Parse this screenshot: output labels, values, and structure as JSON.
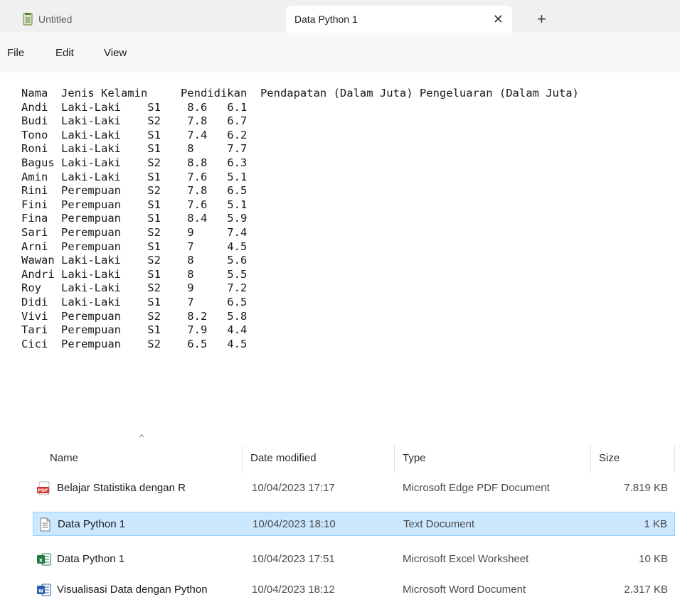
{
  "notepad": {
    "tabs": [
      {
        "title": "Untitled"
      },
      {
        "title": "Data Python 1"
      }
    ],
    "menu": [
      "File",
      "Edit",
      "View"
    ],
    "content": "Nama  Jenis Kelamin     Pendidikan  Pendapatan (Dalam Juta) Pengeluaran (Dalam Juta)\nAndi  Laki-Laki    S1    8.6   6.1\nBudi  Laki-Laki    S2    7.8   6.7\nTono  Laki-Laki    S1    7.4   6.2\nRoni  Laki-Laki    S1    8     7.7\nBagus Laki-Laki    S2    8.8   6.3\nAmin  Laki-Laki    S1    7.6   5.1\nRini  Perempuan    S2    7.8   6.5\nFini  Perempuan    S1    7.6   5.1\nFina  Perempuan    S1    8.4   5.9\nSari  Perempuan    S2    9     7.4\nArni  Perempuan    S1    7     4.5\nWawan Laki-Laki    S2    8     5.6\nAndri Laki-Laki    S1    8     5.5\nRoy   Laki-Laki    S2    9     7.2\nDidi  Laki-Laki    S1    7     6.5\nVivi  Perempuan    S2    8.2   5.8\nTari  Perempuan    S1    7.9   4.4\nCici  Perempuan    S2    6.5   4.5"
  },
  "explorer": {
    "columns": {
      "name": "Name",
      "date": "Date modified",
      "type": "Type",
      "size": "Size"
    },
    "files": [
      {
        "name": "Belajar Statistika dengan R",
        "date": "10/04/2023 17:17",
        "type": "Microsoft Edge PDF Document",
        "size": "7.819 KB",
        "icon": "pdf-file-icon",
        "selected": false
      },
      {
        "name": "Data Python 1",
        "date": "10/04/2023 18:10",
        "type": "Text Document",
        "size": "1 KB",
        "icon": "text-file-icon",
        "selected": true
      },
      {
        "name": "Data Python 1",
        "date": "10/04/2023 17:51",
        "type": "Microsoft Excel Worksheet",
        "size": "10 KB",
        "icon": "excel-file-icon",
        "selected": false
      },
      {
        "name": "Visualisasi Data dengan Python",
        "date": "10/04/2023 18:12",
        "type": "Microsoft Word Document",
        "size": "2.317 KB",
        "icon": "word-file-icon",
        "selected": false
      }
    ]
  },
  "colors": {
    "selection_bg": "#cce8ff",
    "selection_border": "#99d1ff",
    "pdf": "#d0312d",
    "excel": "#1d7a45",
    "word": "#2b5cab"
  }
}
